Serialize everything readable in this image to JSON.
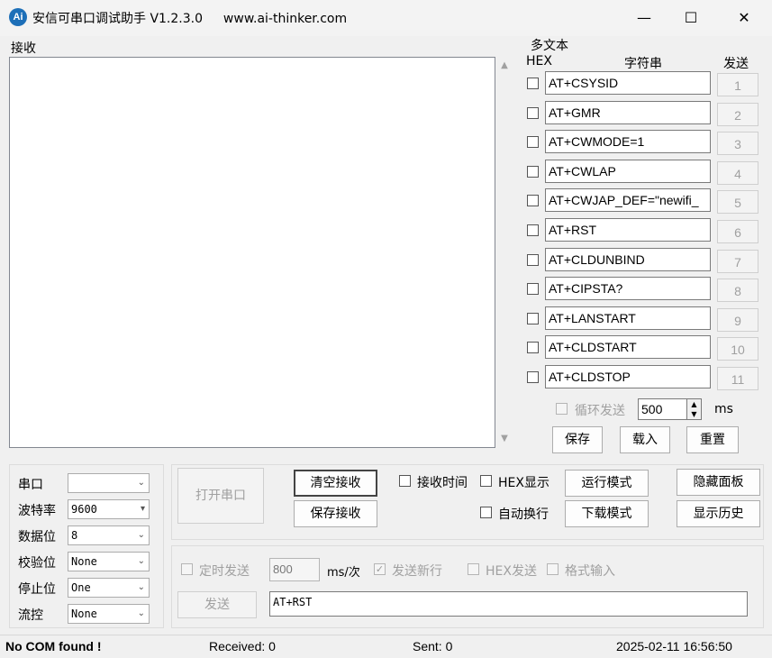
{
  "window": {
    "title": "安信可串口调试助手 V1.2.3.0",
    "website": "www.ai-thinker.com",
    "icon_text": "Ai",
    "icon": "app-logo-icon",
    "controls": {
      "minimize": "—",
      "maximize": "☐",
      "close": "✕"
    }
  },
  "receive": {
    "label": "接收",
    "scroll_up": "▲",
    "scroll_down": "▼"
  },
  "multi": {
    "title": "多文本",
    "headers": {
      "hex": "HEX",
      "string": "字符串",
      "send": "发送"
    },
    "rows": [
      {
        "text": "AT+CSYSID",
        "num": "1"
      },
      {
        "text": "AT+GMR",
        "num": "2"
      },
      {
        "text": "AT+CWMODE=1",
        "num": "3"
      },
      {
        "text": "AT+CWLAP",
        "num": "4"
      },
      {
        "text": "AT+CWJAP_DEF=\"newifi_",
        "num": "5"
      },
      {
        "text": "AT+RST",
        "num": "6"
      },
      {
        "text": "AT+CLDUNBIND",
        "num": "7"
      },
      {
        "text": "AT+CIPSTA?",
        "num": "8"
      },
      {
        "text": "AT+LANSTART",
        "num": "9"
      },
      {
        "text": "AT+CLDSTART",
        "num": "10"
      },
      {
        "text": "AT+CLDSTOP",
        "num": "11"
      }
    ],
    "loop_label": "循环发送",
    "loop_value": "500",
    "loop_unit": "ms",
    "spin_up": "▲",
    "spin_down": "▼",
    "save": "保存",
    "load": "载入",
    "reset": "重置"
  },
  "port": {
    "port_label": "串口",
    "port_value": "",
    "baud_label": "波特率",
    "baud_value": "9600",
    "data_label": "数据位",
    "data_value": "8",
    "parity_label": "校验位",
    "parity_value": "None",
    "stop_label": "停止位",
    "stop_value": "One",
    "flow_label": "流控",
    "flow_value": "None",
    "dropdown": "⌄",
    "dropdown_filled": "▾"
  },
  "actions": {
    "open_port": "打开串口",
    "clear_recv": "清空接收",
    "save_recv": "保存接收",
    "recv_time": "接收时间",
    "hex_show": "HEX显示",
    "auto_wrap": "自动换行",
    "run_mode": "运行模式",
    "download_mode": "下载模式",
    "hide_panel": "隐藏面板",
    "show_history": "显示历史"
  },
  "send": {
    "timed": "定时发送",
    "interval": "800",
    "interval_unit": "ms/次",
    "newline": "发送新行",
    "hex_send": "HEX发送",
    "format_input": "格式输入",
    "send_button": "发送",
    "input_value": "AT+RST",
    "check_mark": "✓"
  },
  "status": {
    "com": "No COM found !",
    "received": "Received: 0",
    "sent": "Sent: 0",
    "datetime": "2025-02-11 16:56:50"
  }
}
